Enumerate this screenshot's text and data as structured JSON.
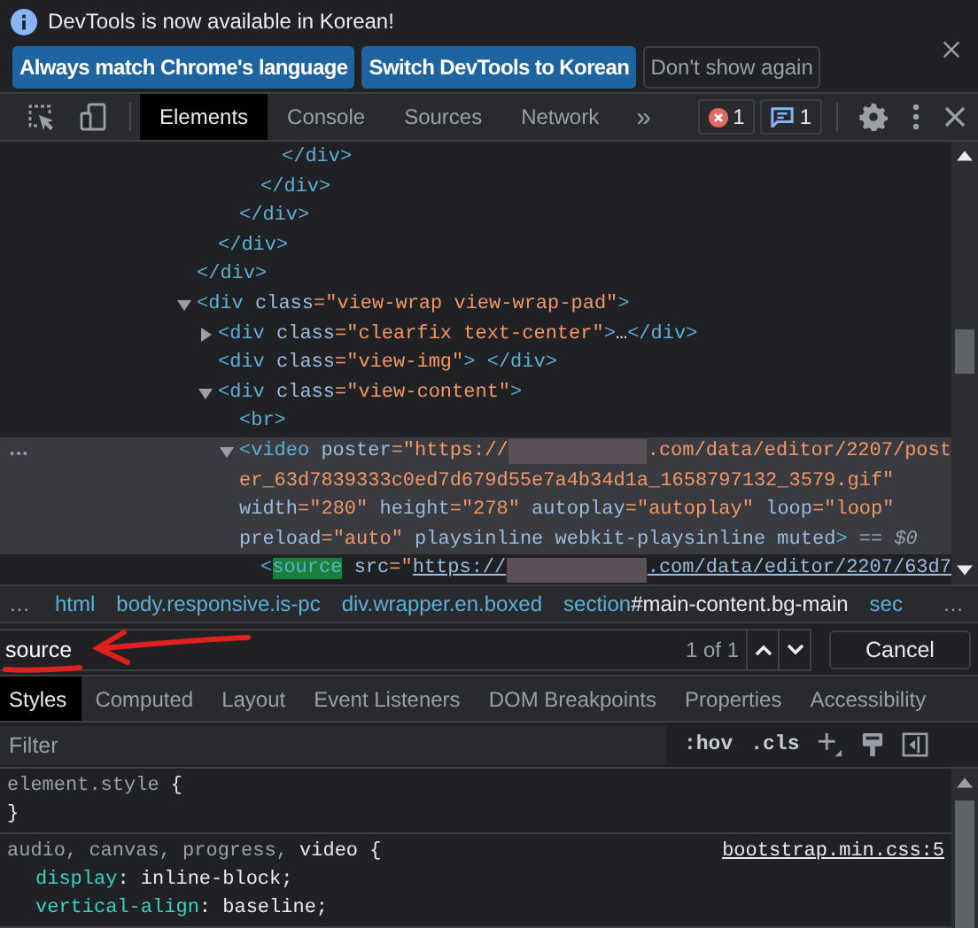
{
  "infobar": {
    "message": "DevTools is now available in Korean!",
    "buttons": [
      {
        "label": "Always match Chrome's language",
        "kind": "primary"
      },
      {
        "label": "Switch DevTools to Korean",
        "kind": "primary"
      },
      {
        "label": "Don't show again",
        "kind": "secondary"
      }
    ]
  },
  "toolbar": {
    "tabs": [
      {
        "label": "Elements",
        "selected": true
      },
      {
        "label": "Console",
        "selected": false
      },
      {
        "label": "Sources",
        "selected": false
      },
      {
        "label": "Network",
        "selected": false
      }
    ],
    "more": "»",
    "badges": [
      {
        "kind": "error",
        "count": "1"
      },
      {
        "kind": "message",
        "count": "1"
      }
    ]
  },
  "dom_tree": [
    {
      "selected": false,
      "children": [
        {
          "selected": false,
          "children": [
            {
              "selected": false,
              "children": [
                {
                  "selected": false,
                  "children": [
                    {
                      "selected": false,
                      "close": [
                        {
                          "kind": "tag",
                          "text": "</div>"
                        }
                      ]
                    }
                  ],
                  "close": [
                    {
                      "kind": "tag",
                      "text": "</div>"
                    }
                  ]
                }
              ],
              "close": [
                {
                  "kind": "tag",
                  "text": "</div>"
                }
              ]
            }
          ],
          "close": [
            {
              "kind": "tag",
              "text": "</div>"
            }
          ]
        }
      ],
      "close": [
        {
          "kind": "tag",
          "text": "</div>"
        }
      ]
    },
    {
      "selected": false,
      "expanded": true,
      "lines": [
        [
          {
            "kind": "tag",
            "text": "<div"
          },
          {
            "kind": "attr",
            "text": " class"
          },
          {
            "kind": "value",
            "text": "=\"view-wrap view-wrap-pad\""
          },
          {
            "kind": "tag",
            "text": ">"
          }
        ]
      ],
      "children": [
        {
          "selected": false,
          "expanded": false,
          "lines": [
            [
              {
                "kind": "tag",
                "text": "<div"
              },
              {
                "kind": "attr",
                "text": " class"
              },
              {
                "kind": "value",
                "text": "=\"clearfix text-center\""
              },
              {
                "kind": "tag",
                "text": ">"
              },
              {
                "kind": "plain",
                "text": "…"
              },
              {
                "kind": "tag",
                "text": "</div>"
              }
            ]
          ]
        },
        {
          "selected": false,
          "lines": [
            [
              {
                "kind": "tag",
                "text": "<div"
              },
              {
                "kind": "attr",
                "text": " class"
              },
              {
                "kind": "value",
                "text": "=\"view-img\""
              },
              {
                "kind": "tag",
                "text": "> </div>"
              }
            ]
          ]
        },
        {
          "selected": false,
          "expanded": true,
          "lines": [
            [
              {
                "kind": "tag",
                "text": "<div"
              },
              {
                "kind": "attr",
                "text": " class"
              },
              {
                "kind": "value",
                "text": "=\"view-content\""
              },
              {
                "kind": "tag",
                "text": ">"
              }
            ]
          ],
          "children": [
            {
              "selected": false,
              "lines": [
                [
                  {
                    "kind": "tag",
                    "text": "<br>"
                  }
                ]
              ]
            },
            {
              "selected": true,
              "expanded": true,
              "lines": [
                [
                  {
                    "kind": "tag",
                    "text": "<video"
                  },
                  {
                    "kind": "attr",
                    "text": " poster"
                  },
                  {
                    "kind": "value",
                    "text": "=\"https://"
                  },
                  {
                    "kind": "redact"
                  },
                  {
                    "kind": "value",
                    "text": ".com/data/editor/2207/post"
                  }
                ],
                [
                  {
                    "kind": "value",
                    "text": "er_63d7839333c0ed7d679d55e7a4b34d1a_1658797132_3579.gif\""
                  }
                ],
                [
                  {
                    "kind": "attr",
                    "text": "width"
                  },
                  {
                    "kind": "value",
                    "text": "=\"280\""
                  },
                  {
                    "kind": "attr",
                    "text": " height"
                  },
                  {
                    "kind": "value",
                    "text": "=\"278\""
                  },
                  {
                    "kind": "attr",
                    "text": " autoplay"
                  },
                  {
                    "kind": "value",
                    "text": "=\"autoplay\""
                  },
                  {
                    "kind": "attr",
                    "text": " loop"
                  },
                  {
                    "kind": "value",
                    "text": "=\"loop\""
                  }
                ],
                [
                  {
                    "kind": "attr",
                    "text": "preload"
                  },
                  {
                    "kind": "value",
                    "text": "=\"auto\""
                  },
                  {
                    "kind": "attr",
                    "text": " playsinline webkit-playsinline muted"
                  },
                  {
                    "kind": "tag",
                    "text": ">"
                  },
                  {
                    "kind": "dim",
                    "text": " == $0"
                  }
                ]
              ],
              "children": [
                {
                  "selected": false,
                  "lines": [
                    [
                      {
                        "kind": "tag",
                        "text": "<"
                      },
                      {
                        "kind": "match",
                        "text": "source"
                      },
                      {
                        "kind": "attr",
                        "text": " src"
                      },
                      {
                        "kind": "value",
                        "text": "=\""
                      },
                      {
                        "kind": "link",
                        "text": "https://"
                      },
                      {
                        "kind": "redact"
                      },
                      {
                        "kind": "link",
                        "text": ".com/data/editor/2207/63d7"
                      }
                    ]
                  ]
                }
              ]
            }
          ]
        }
      ]
    }
  ],
  "breadcrumbs": {
    "left": "…",
    "items": [
      {
        "tag": "html"
      },
      {
        "tag": "body.responsive.is-pc"
      },
      {
        "tag": "div.wrapper.en.boxed"
      },
      {
        "tag": "section",
        "suffix": "#main-content.bg-main"
      },
      {
        "tag": "sec"
      }
    ],
    "right": "…"
  },
  "search": {
    "value": "source",
    "count": "1 of 1",
    "cancel": "Cancel"
  },
  "styles_tabs": [
    {
      "label": "Styles",
      "selected": true
    },
    {
      "label": "Computed",
      "selected": false
    },
    {
      "label": "Layout",
      "selected": false
    },
    {
      "label": "Event Listeners",
      "selected": false
    },
    {
      "label": "DOM Breakpoints",
      "selected": false
    },
    {
      "label": "Properties",
      "selected": false
    },
    {
      "label": "Accessibility",
      "selected": false
    }
  ],
  "filter": {
    "placeholder": "Filter",
    "toggles": [
      ":hov",
      ".cls"
    ]
  },
  "rules": [
    {
      "selector": [
        {
          "text": "element.style",
          "matched": false
        }
      ],
      "open": "{",
      "close": "}"
    },
    {
      "selector": [
        {
          "text": "audio, canvas, progress, ",
          "matched": false
        },
        {
          "text": "video",
          "matched": true
        }
      ],
      "open": "{",
      "source": "bootstrap.min.css:5",
      "properties": [
        {
          "name": "display",
          "separator": ":",
          "value": "inline-block;"
        },
        {
          "name": "vertical-align",
          "separator": ":",
          "value": "baseline;"
        }
      ]
    }
  ]
}
